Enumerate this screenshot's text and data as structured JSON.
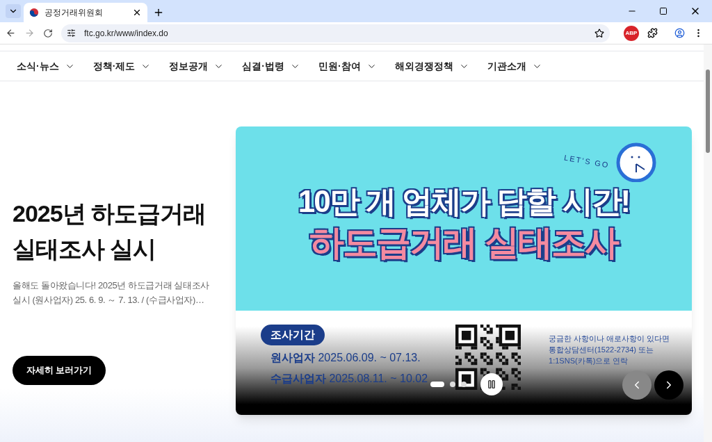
{
  "browser": {
    "tab": {
      "title": "공정거래위원회"
    },
    "url": "ftc.go.kr/www/index.do",
    "extension_badge": "ABP"
  },
  "nav": [
    {
      "label": "소식·뉴스"
    },
    {
      "label": "정책·제도"
    },
    {
      "label": "정보공개"
    },
    {
      "label": "심결·법령"
    },
    {
      "label": "민원·참여"
    },
    {
      "label": "해외경쟁정책"
    },
    {
      "label": "기관소개"
    }
  ],
  "hero": {
    "title_lines": [
      "2025년 하도급거래",
      "실태조사 실시"
    ],
    "summary_lines": [
      "올해도 돌아왔습니다! 2025년 하도급거래 실태조사",
      "실시 (원사업자) 25. 6. 9. ～ 7. 13. / (수급사업자)…"
    ],
    "button": "자세히 보러가기"
  },
  "banner": {
    "tagline": "LET'S GO",
    "headline": "10만 개 업체가 답할 시간!",
    "subhead": "하도급거래 실태조사",
    "period_badge": "조사기간",
    "periods": [
      {
        "who": "원사업자",
        "dates": "2025.06.09. ~ 07.13."
      },
      {
        "who": "수급사업자",
        "dates": "2025.08.11. ~ 10.02"
      }
    ],
    "contact_lines": [
      "궁금한 사항이나 애로사항이 있다면",
      "통합상담센터(1522-2734) 또는",
      "1:1SNS(카톡)으로 연락"
    ]
  },
  "carousel": {
    "dots": [
      {
        "selected": true
      },
      {
        "selected": false
      },
      {
        "selected": false
      }
    ],
    "paused": false
  }
}
